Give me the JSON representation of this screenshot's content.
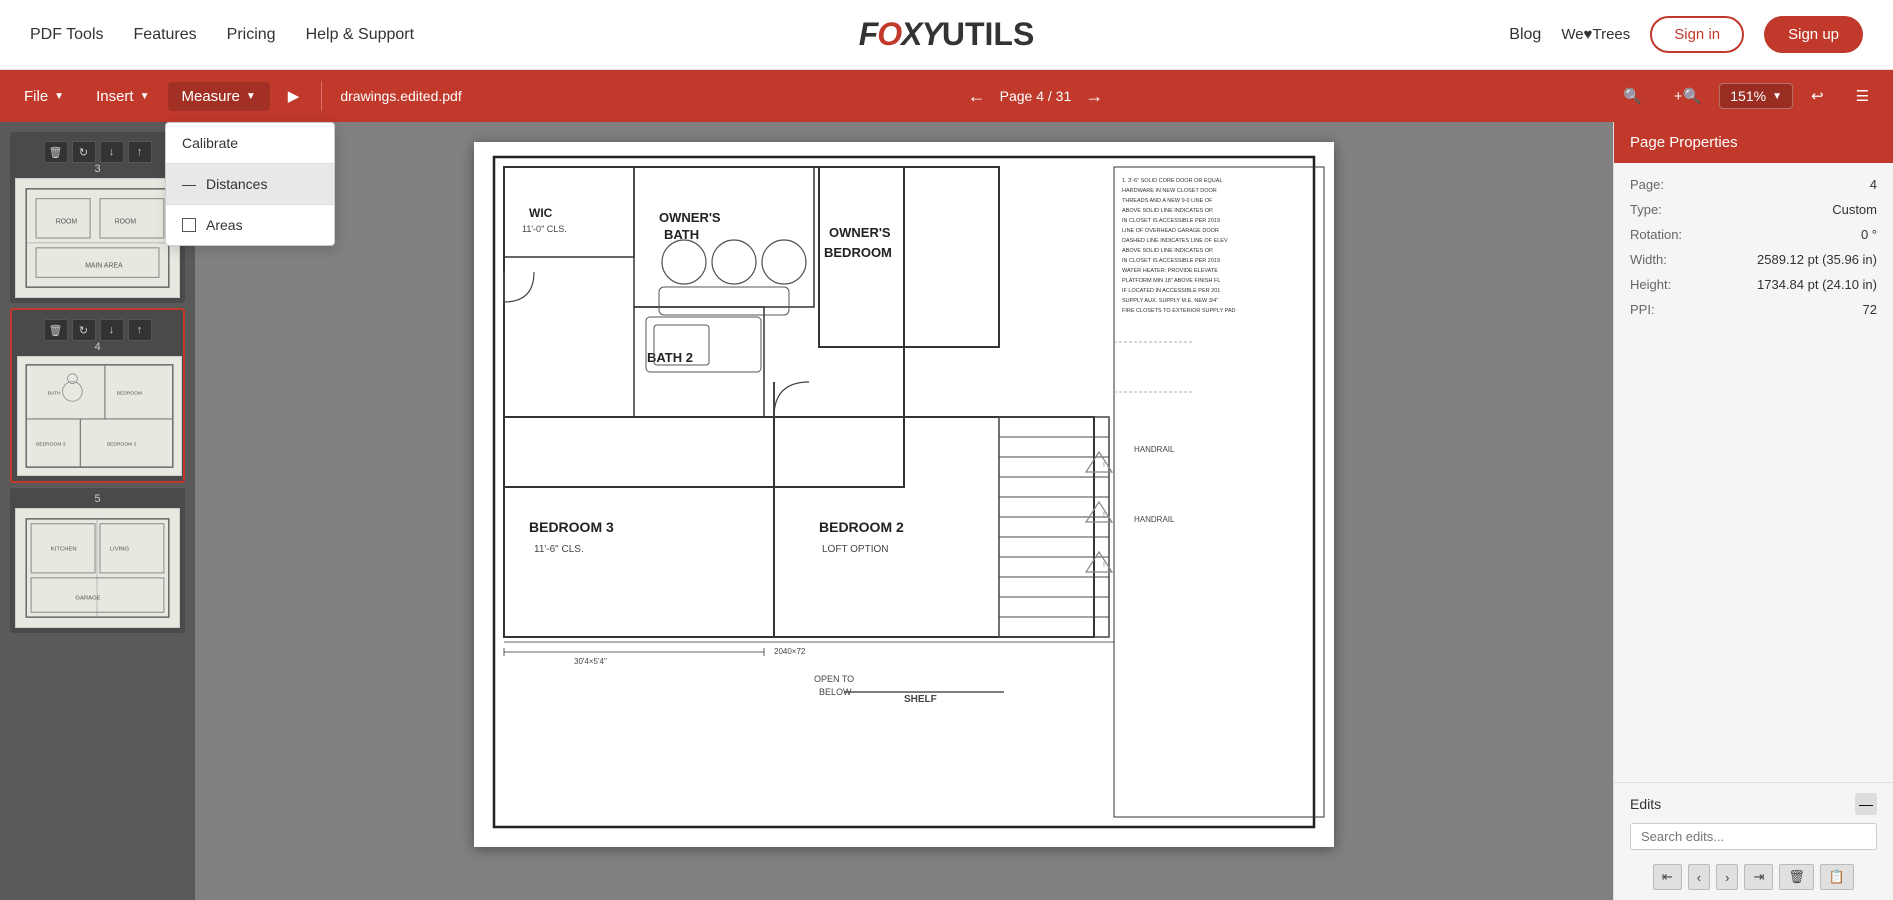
{
  "nav": {
    "links": [
      "PDF Tools",
      "Features",
      "Pricing",
      "Help & Support"
    ],
    "blog_label": "Blog",
    "wetrees_label": "We♥Trees",
    "signin_label": "Sign in",
    "signup_label": "Sign up",
    "logo_part1": "FOX",
    "logo_part2": "YUTILS"
  },
  "toolbar": {
    "file_label": "File",
    "insert_label": "Insert",
    "measure_label": "Measure",
    "select_label": "▶",
    "filename": "drawings.edited.pdf",
    "page_info": "Page 4 / 31",
    "zoom_level": "151%"
  },
  "dropdown": {
    "calibrate_label": "Calibrate",
    "distances_label": "Distances",
    "areas_label": "Areas"
  },
  "sidebar": {
    "thumbnails": [
      {
        "page": "3"
      },
      {
        "page": "4"
      },
      {
        "page": "5"
      }
    ]
  },
  "page_properties": {
    "title": "Page Properties",
    "page_label": "Page:",
    "page_value": "4",
    "type_label": "Type:",
    "type_value": "Custom",
    "rotation_label": "Rotation:",
    "rotation_value": "0 °",
    "width_label": "Width:",
    "width_value": "2589.12 pt (35.96 in)",
    "height_label": "Height:",
    "height_value": "1734.84 pt (24.10 in)",
    "ppi_label": "PPI:",
    "ppi_value": "72",
    "edits_label": "Edits",
    "edits_search_placeholder": ""
  }
}
